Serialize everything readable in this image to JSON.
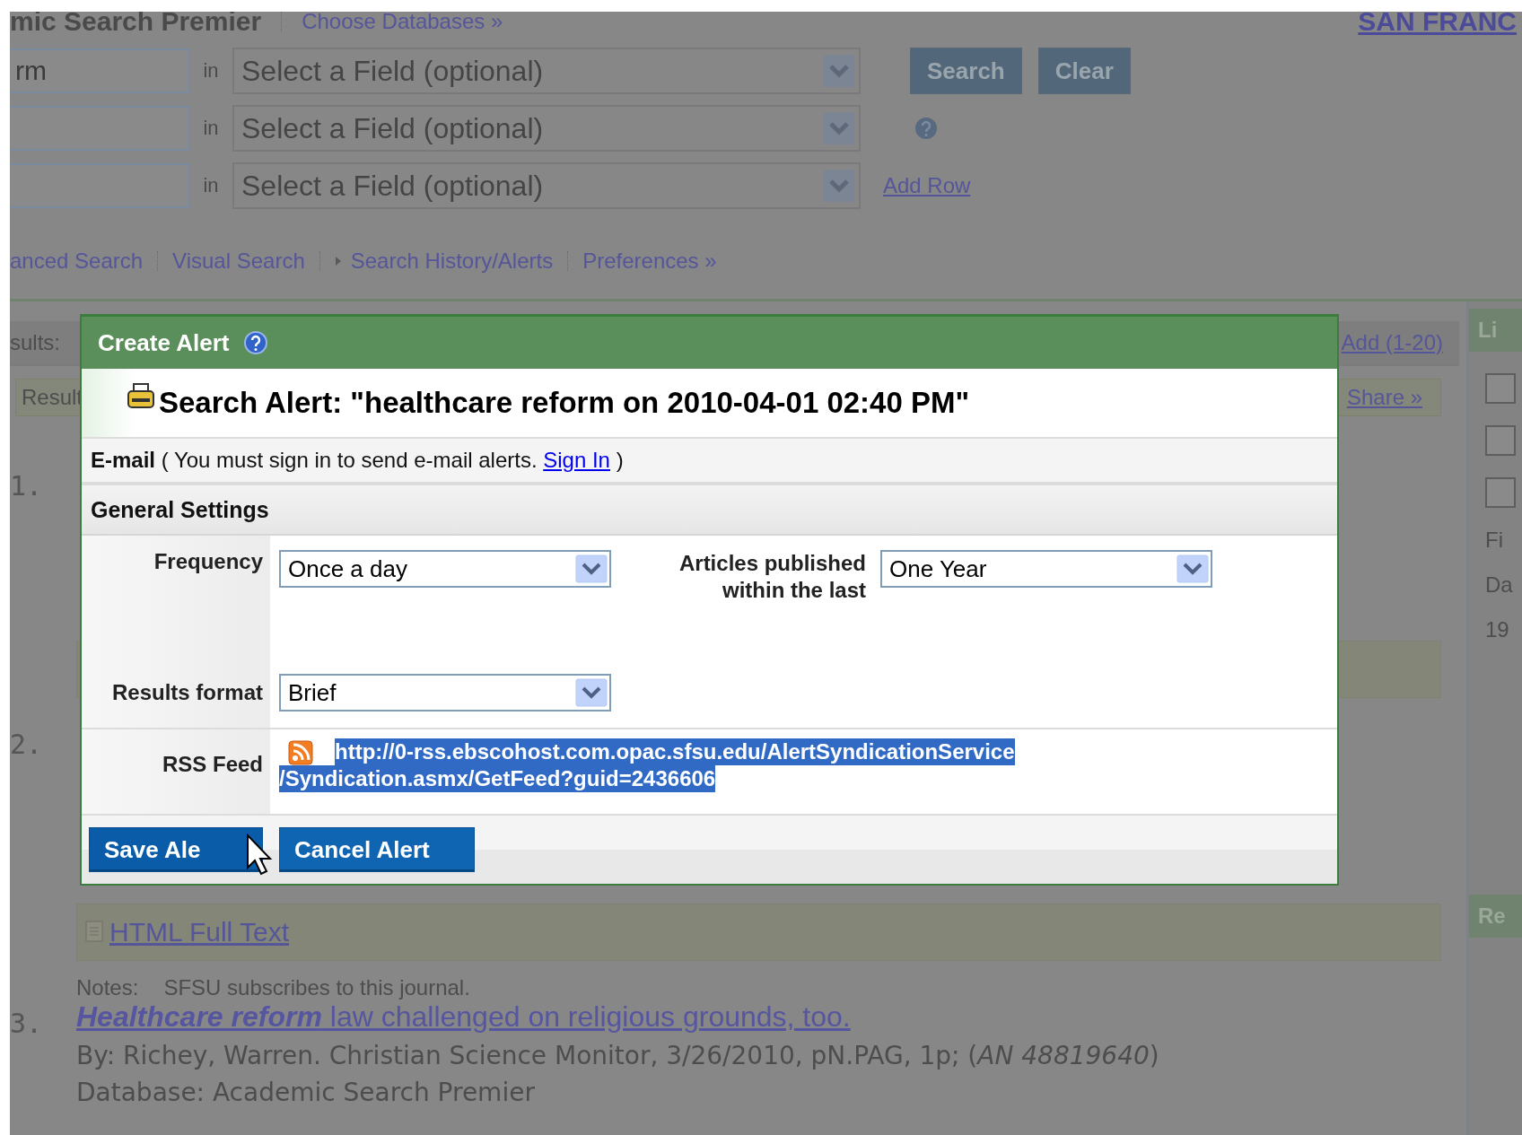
{
  "header": {
    "title": "mic Search Premier",
    "choose_databases": "Choose Databases »",
    "institution": "SAN FRANC"
  },
  "search_rows": [
    {
      "term": "rm",
      "in_label": "in",
      "field": "Select a Field (optional)"
    },
    {
      "in_label": "in",
      "field": "Select a Field (optional)"
    },
    {
      "in_label": "in",
      "field": "Select a Field (optional)"
    }
  ],
  "search_button": "Search",
  "clear_button": "Clear",
  "add_row": "Add Row",
  "nav_links": [
    {
      "label": "anced Search",
      "kind": "plain"
    },
    {
      "label": "Visual Search",
      "kind": "plain"
    },
    {
      "label": "Search History/Alerts",
      "kind": "arrow"
    },
    {
      "label": "Preferences »",
      "kind": "plain"
    }
  ],
  "results": {
    "count_label": "sults:",
    "add_link": "Add (1-20)",
    "toolbar_label": "Result",
    "share_link": "Share »",
    "items": [
      {
        "number": "1.",
        "kind": "covered"
      },
      {
        "number": "2.",
        "kind": "fulltext",
        "full_text_link": "HTML Full Text",
        "notes_label": "Notes:",
        "notes": "SFSU subscribes to this journal."
      },
      {
        "number": "3.",
        "kind": "article",
        "title": "**Healthcare reform** law challenged on religious grounds, too.",
        "byline": "By: Richey, Warren. Christian Science Monitor, 3/26/2010, pN.PAG, 1p; (*AN 48819640*)",
        "database": "Database: Academic Search Premier"
      }
    ]
  },
  "side_panel": {
    "header": "Li",
    "checkboxes": [
      {
        "checked": false
      },
      {
        "checked": false
      },
      {
        "checked": false
      }
    ],
    "labels": [
      "Fi",
      "Da",
      "19"
    ],
    "footer_header": "Re"
  },
  "dialog": {
    "title": "Create Alert",
    "alert_title": "Search Alert: \"healthcare reform on 2010-04-01 02:40 PM\"",
    "email_notice": {
      "text": "**E-mail** ( You must sign in to send e-mail alerts.",
      "link": "Sign In",
      "after": ")"
    },
    "section": "General Settings",
    "fields": [
      {
        "label": "Frequency",
        "value": "Once a day"
      },
      {
        "label": "Articles published within the last",
        "value": "One Year"
      },
      {
        "label": "Results format",
        "value": "Brief"
      }
    ],
    "rss": {
      "label": "RSS Feed",
      "url_lines": [
        "http://0-rss.ebscohost.com.opac.sfsu.edu/AlertSyndicationService",
        "/Syndication.asmx/GetFeed?guid=2436606"
      ],
      "selected": true
    },
    "buttons": [
      {
        "label": "Save Ale",
        "hovered": true
      },
      {
        "label": "Cancel Alert",
        "hovered": false
      }
    ]
  }
}
